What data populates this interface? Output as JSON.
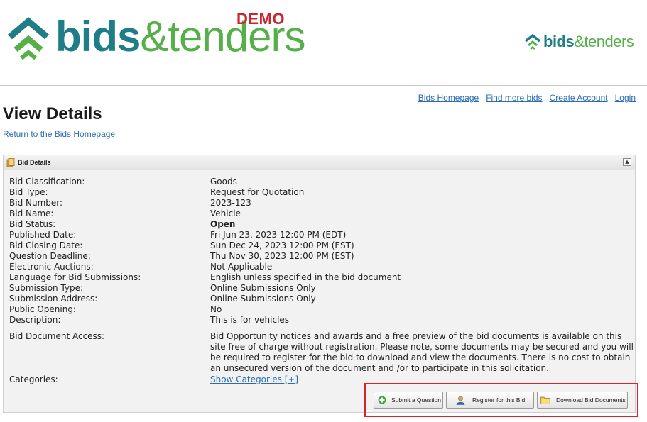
{
  "header": {
    "logo_bids": "bids",
    "logo_amp": "&",
    "logo_tenders": "tenders",
    "demo": "DEMO",
    "small_logo_bids": "bids",
    "small_logo_amp": "&",
    "small_logo_tenders": "tenders"
  },
  "nav": {
    "links": [
      "Bids Homepage",
      "Find more bids",
      "Create Account",
      "Login"
    ]
  },
  "page": {
    "title": "View Details",
    "return_link": "Return to the Bids Homepage"
  },
  "panel": {
    "title": "Bid Details",
    "rows": [
      {
        "label": "Bid Classification:",
        "value": "Goods"
      },
      {
        "label": "Bid Type:",
        "value": "Request for Quotation"
      },
      {
        "label": "Bid Number:",
        "value": "2023-123"
      },
      {
        "label": "Bid Name:",
        "value": "Vehicle"
      },
      {
        "label": "Bid Status:",
        "value": "Open"
      },
      {
        "label": "Published Date:",
        "value": "Fri Jun 23, 2023 12:00 PM (EDT)"
      },
      {
        "label": "Bid Closing Date:",
        "value": "Sun Dec 24, 2023 12:00 PM (EST)"
      },
      {
        "label": "Question Deadline:",
        "value": "Thu Nov 30, 2023 12:00 PM (EST)"
      },
      {
        "label": "Electronic Auctions:",
        "value": "Not Applicable"
      },
      {
        "label": "Language for Bid Submissions:",
        "value": "English unless specified in the bid document"
      },
      {
        "label": "Submission Type:",
        "value": "Online Submissions Only"
      },
      {
        "label": "Submission Address:",
        "value": "Online Submissions Only"
      },
      {
        "label": "Public Opening:",
        "value": "No"
      },
      {
        "label": "Description:",
        "value": "This is for vehicles"
      }
    ],
    "access_label": "Bid Document Access:",
    "access_value": "Bid Opportunity notices and awards and a free preview of the bid documents is available on this site free of charge without registration. Please note, some documents may be secured and you will be required to register for the bid to download and view the documents. There is no cost to obtain an unsecured version of the document and /or to participate in this solicitation.",
    "categories_label": "Categories:",
    "categories_link": "Show Categories [+]"
  },
  "buttons": {
    "submit_question": "Submit a Question",
    "register": "Register for this Bid",
    "download": "Download Bid Documents"
  },
  "colors": {
    "brand_teal": "#1e7d87",
    "brand_green": "#56b04a",
    "demo_red": "#c8262e",
    "link_blue": "#2a6db3",
    "highlight_red": "#d9232e"
  }
}
